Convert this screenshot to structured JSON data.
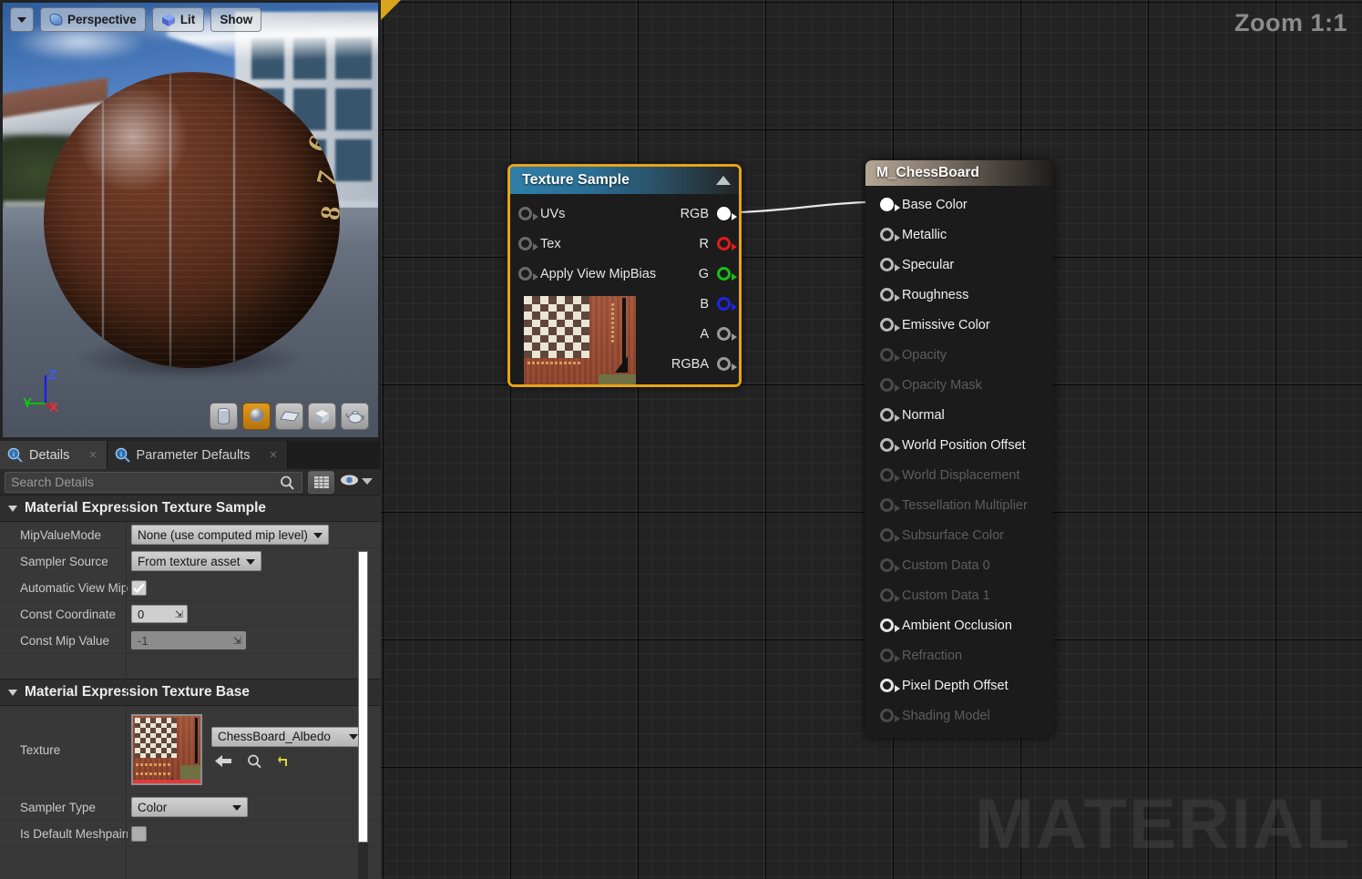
{
  "viewport": {
    "toolbar": {
      "dropdown_icon": "caret-down-icon",
      "perspective_label": "Perspective",
      "lit_label": "Lit",
      "show_label": "Show"
    },
    "gizmo": {
      "z": "Z",
      "y": "Y",
      "x": "X"
    },
    "sphere_digits": [
      "6",
      "7",
      "8"
    ],
    "shape_buttons": [
      {
        "name": "cylinder",
        "active": false
      },
      {
        "name": "sphere",
        "active": true
      },
      {
        "name": "plane",
        "active": false
      },
      {
        "name": "cube",
        "active": false
      },
      {
        "name": "teapot",
        "active": false
      }
    ]
  },
  "details": {
    "tabs": [
      {
        "label": "Details",
        "icon": "details-magnifier-icon",
        "active": true
      },
      {
        "label": "Parameter Defaults",
        "icon": "details-magnifier-icon",
        "active": false
      }
    ],
    "search": {
      "placeholder": "Search Details",
      "value": ""
    },
    "toolbar": {
      "grid_view_icon": "grid-view-icon",
      "eye_icon": "eye-icon",
      "chevron_icon": "chevron-down-icon"
    },
    "sections": [
      {
        "title": "Material Expression Texture Sample",
        "rows": [
          {
            "label": "MipValueMode",
            "type": "combo",
            "value": "None (use computed mip level)"
          },
          {
            "label": "Sampler Source",
            "type": "combo",
            "value": "From texture asset"
          },
          {
            "label": "Automatic View Mip",
            "type": "checkbox",
            "value": "checked"
          },
          {
            "label": "Const Coordinate",
            "type": "number",
            "value": "0"
          },
          {
            "label": "Const Mip Value",
            "type": "number-disabled",
            "value": "-1"
          }
        ]
      },
      {
        "title": "Material Expression Texture Base",
        "rows": [
          {
            "label": "Texture",
            "type": "asset",
            "value": "ChessBoard_Albedo",
            "actions": [
              "back-arrow-icon",
              "browse-magnifier-icon",
              "reset-arrow-icon"
            ]
          },
          {
            "label": "Sampler Type",
            "type": "combo",
            "value": "Color"
          },
          {
            "label": "Is Default Meshpaint",
            "type": "checkbox",
            "value": "unchecked"
          }
        ]
      }
    ]
  },
  "graph": {
    "zoom_label": "Zoom 1:1",
    "watermark": "MATERIAL",
    "nodes": [
      {
        "id": "texture-sample",
        "title": "Texture Sample",
        "collapse_icon": "collapse-triangle-icon",
        "inputs": [
          {
            "label": "UVs",
            "color": "#6a6a6a",
            "style": "hollow"
          },
          {
            "label": "Tex",
            "color": "#6a6a6a",
            "style": "hollow"
          },
          {
            "label": "Apply View MipBias",
            "color": "#6a6a6a",
            "style": "hollow"
          }
        ],
        "outputs": [
          {
            "label": "RGB",
            "color": "#ffffff",
            "style": "filled"
          },
          {
            "label": "R",
            "color": "#e01b1b",
            "style": "hollow"
          },
          {
            "label": "G",
            "color": "#17c017",
            "style": "hollow"
          },
          {
            "label": "B",
            "color": "#2222e8",
            "style": "hollow"
          },
          {
            "label": "A",
            "color": "#9a9a9a",
            "style": "hollow"
          },
          {
            "label": "RGBA",
            "color": "#9a9a9a",
            "style": "hollow"
          }
        ]
      },
      {
        "id": "material-output",
        "title": "M_ChessBoard",
        "inputs": [
          {
            "label": "Base Color",
            "style": "filled",
            "enabled": true
          },
          {
            "label": "Metallic",
            "style": "hollow",
            "enabled": true
          },
          {
            "label": "Specular",
            "style": "hollow",
            "enabled": true
          },
          {
            "label": "Roughness",
            "style": "hollow",
            "enabled": true
          },
          {
            "label": "Emissive Color",
            "style": "hollow",
            "enabled": true
          },
          {
            "label": "Opacity",
            "style": "hollow",
            "enabled": false
          },
          {
            "label": "Opacity Mask",
            "style": "hollow",
            "enabled": false
          },
          {
            "label": "Normal",
            "style": "hollow",
            "enabled": true
          },
          {
            "label": "World Position Offset",
            "style": "hollow",
            "enabled": true
          },
          {
            "label": "World Displacement",
            "style": "hollow",
            "enabled": false
          },
          {
            "label": "Tessellation Multiplier",
            "style": "hollow",
            "enabled": false
          },
          {
            "label": "Subsurface Color",
            "style": "hollow",
            "enabled": false
          },
          {
            "label": "Custom Data 0",
            "style": "hollow",
            "enabled": false
          },
          {
            "label": "Custom Data 1",
            "style": "hollow",
            "enabled": false
          },
          {
            "label": "Ambient Occlusion",
            "style": "filled-ring",
            "enabled": true
          },
          {
            "label": "Refraction",
            "style": "hollow",
            "enabled": false
          },
          {
            "label": "Pixel Depth Offset",
            "style": "filled-ring",
            "enabled": true
          },
          {
            "label": "Shading Model",
            "style": "hollow",
            "enabled": false
          }
        ]
      }
    ],
    "connections": [
      {
        "from": "texture-sample.RGB",
        "to": "material-output.Base Color",
        "color": "#e8e8e8"
      }
    ]
  },
  "colors": {
    "node_selected_border": "#e8a317",
    "graph_bg": "#232323",
    "accent_orange": "#d8a51d"
  }
}
